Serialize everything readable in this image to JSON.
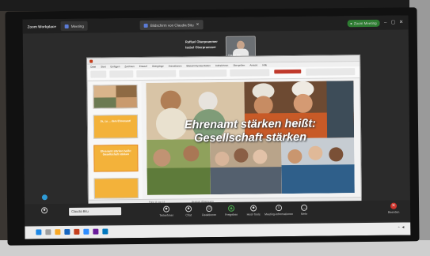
{
  "meeting": {
    "app_title": "Zoom Workplace",
    "tabs": [
      {
        "label": "Meeting"
      },
      {
        "label": "Bildschirm von Claudia Bitu"
      }
    ],
    "account_label": "Zoom Meeting",
    "speakers": [
      {
        "name": "Raffael Oberprammer"
      },
      {
        "name": "Isabel Oberprammer"
      }
    ],
    "thumbnail_name": "Claudia Bitu"
  },
  "presentation": {
    "menu": [
      "Datei",
      "Start",
      "Einfügen",
      "Zeichnen",
      "Entwurf",
      "Übergänge",
      "Animationen",
      "Bildschirmpräsentation",
      "Aufzeichnen",
      "Überprüfen",
      "Ansicht",
      "Hilfe"
    ],
    "slide_title_line1": "Ehrenamt stärken heißt:",
    "slide_title_line2": "Gesellschaft stärken",
    "thumb_texts": [
      "Ja, zu ... dem Ehrenamt!",
      "Ehrenamt stärken heißt: Gesellschaft stärken"
    ],
    "status_left": "Folie 11 von 15",
    "status_lang": "Deutsch (Österreich)"
  },
  "toolbar": {
    "name_tag": "Claudia Bitu",
    "controls": [
      {
        "label": "Teilnehmer"
      },
      {
        "label": "Chat"
      },
      {
        "label": "Reaktionen"
      },
      {
        "label": "Freigeben"
      },
      {
        "label": "Host-Tools"
      },
      {
        "label": "Meeting-Informationen"
      },
      {
        "label": "Mehr"
      }
    ],
    "leave_label": "Beenden"
  },
  "colors": {
    "accent": "#2e7d32",
    "leave": "#d0342c",
    "slide_yellow": "#f3b23a"
  }
}
